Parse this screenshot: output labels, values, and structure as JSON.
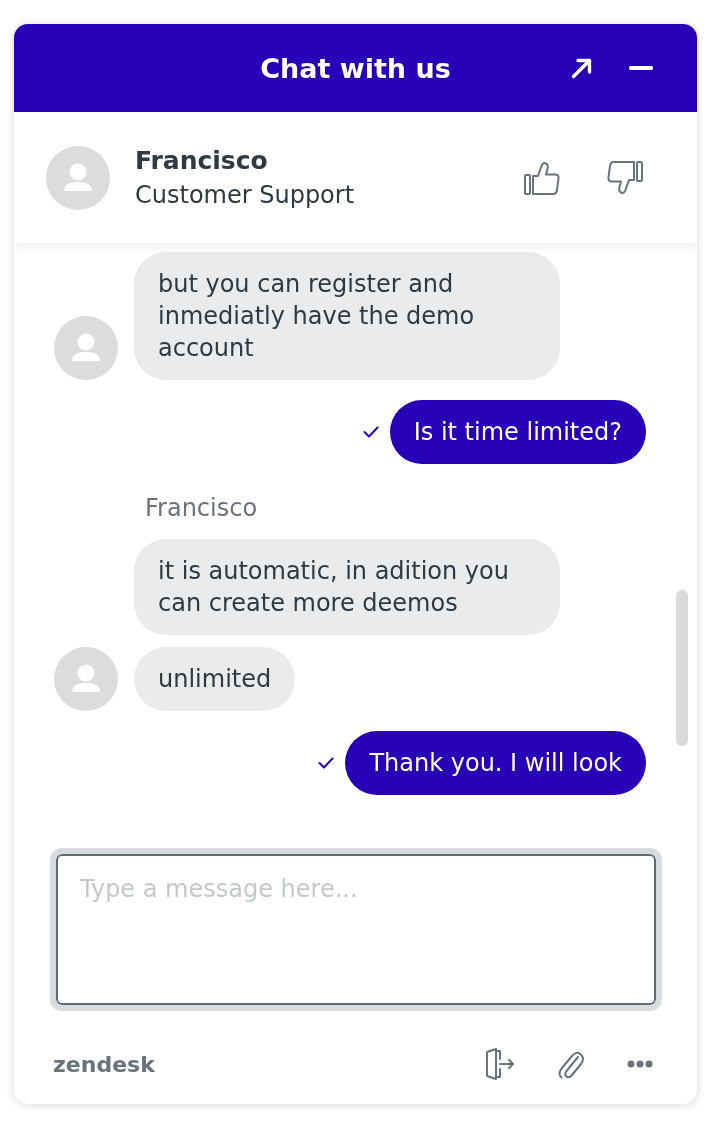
{
  "header": {
    "title": "Chat with us"
  },
  "agent": {
    "name": "Francisco",
    "role": "Customer Support"
  },
  "messages": [
    {
      "kind": "agent",
      "bubbles": [
        "but you can register and inmediatly have the demo account"
      ]
    },
    {
      "kind": "visitor",
      "bubbles": [
        "Is it time limited?"
      ],
      "delivered": true
    },
    {
      "kind": "agent",
      "sender": "Francisco",
      "bubbles": [
        "it is automatic, in adition you can create more deemos",
        "unlimited"
      ]
    },
    {
      "kind": "visitor",
      "bubbles": [
        "Thank you. I will look"
      ],
      "delivered": true
    }
  ],
  "composer": {
    "placeholder": "Type a message here..."
  },
  "footer": {
    "brand": "zendesk"
  }
}
